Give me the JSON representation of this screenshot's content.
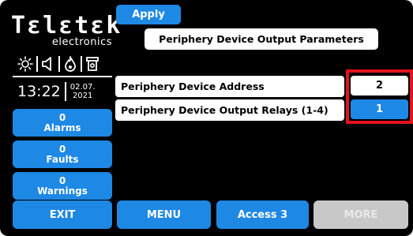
{
  "brand": {
    "name": "Tεlεtεk",
    "sub": "electronics"
  },
  "status_icons": [
    "sun-icon",
    "speaker-icon",
    "flame-icon",
    "smoke-detector-icon"
  ],
  "clock": {
    "time": "13:22",
    "date_line1": "02.07.",
    "date_line2": "2021"
  },
  "sidebar": {
    "alarms": {
      "count": "0",
      "label": "Alarms"
    },
    "faults": {
      "count": "0",
      "label": "Faults"
    },
    "warnings": {
      "count": "0",
      "label": "Warnings"
    }
  },
  "header": {
    "apply_label": "Apply",
    "title": "Periphery Device Output Parameters"
  },
  "rows": [
    {
      "label": "Periphery Device Address",
      "value": "2"
    },
    {
      "label": "Periphery Device Output Relays (1-4)",
      "value": "1"
    }
  ],
  "bottom_bar": {
    "exit": "EXIT",
    "menu": "MENU",
    "access": "Access 3",
    "more": "MORE"
  },
  "colors": {
    "accent": "#1e88e5",
    "highlight": "#e3131e",
    "background": "#000000",
    "disabled": "#c8c8c8"
  }
}
